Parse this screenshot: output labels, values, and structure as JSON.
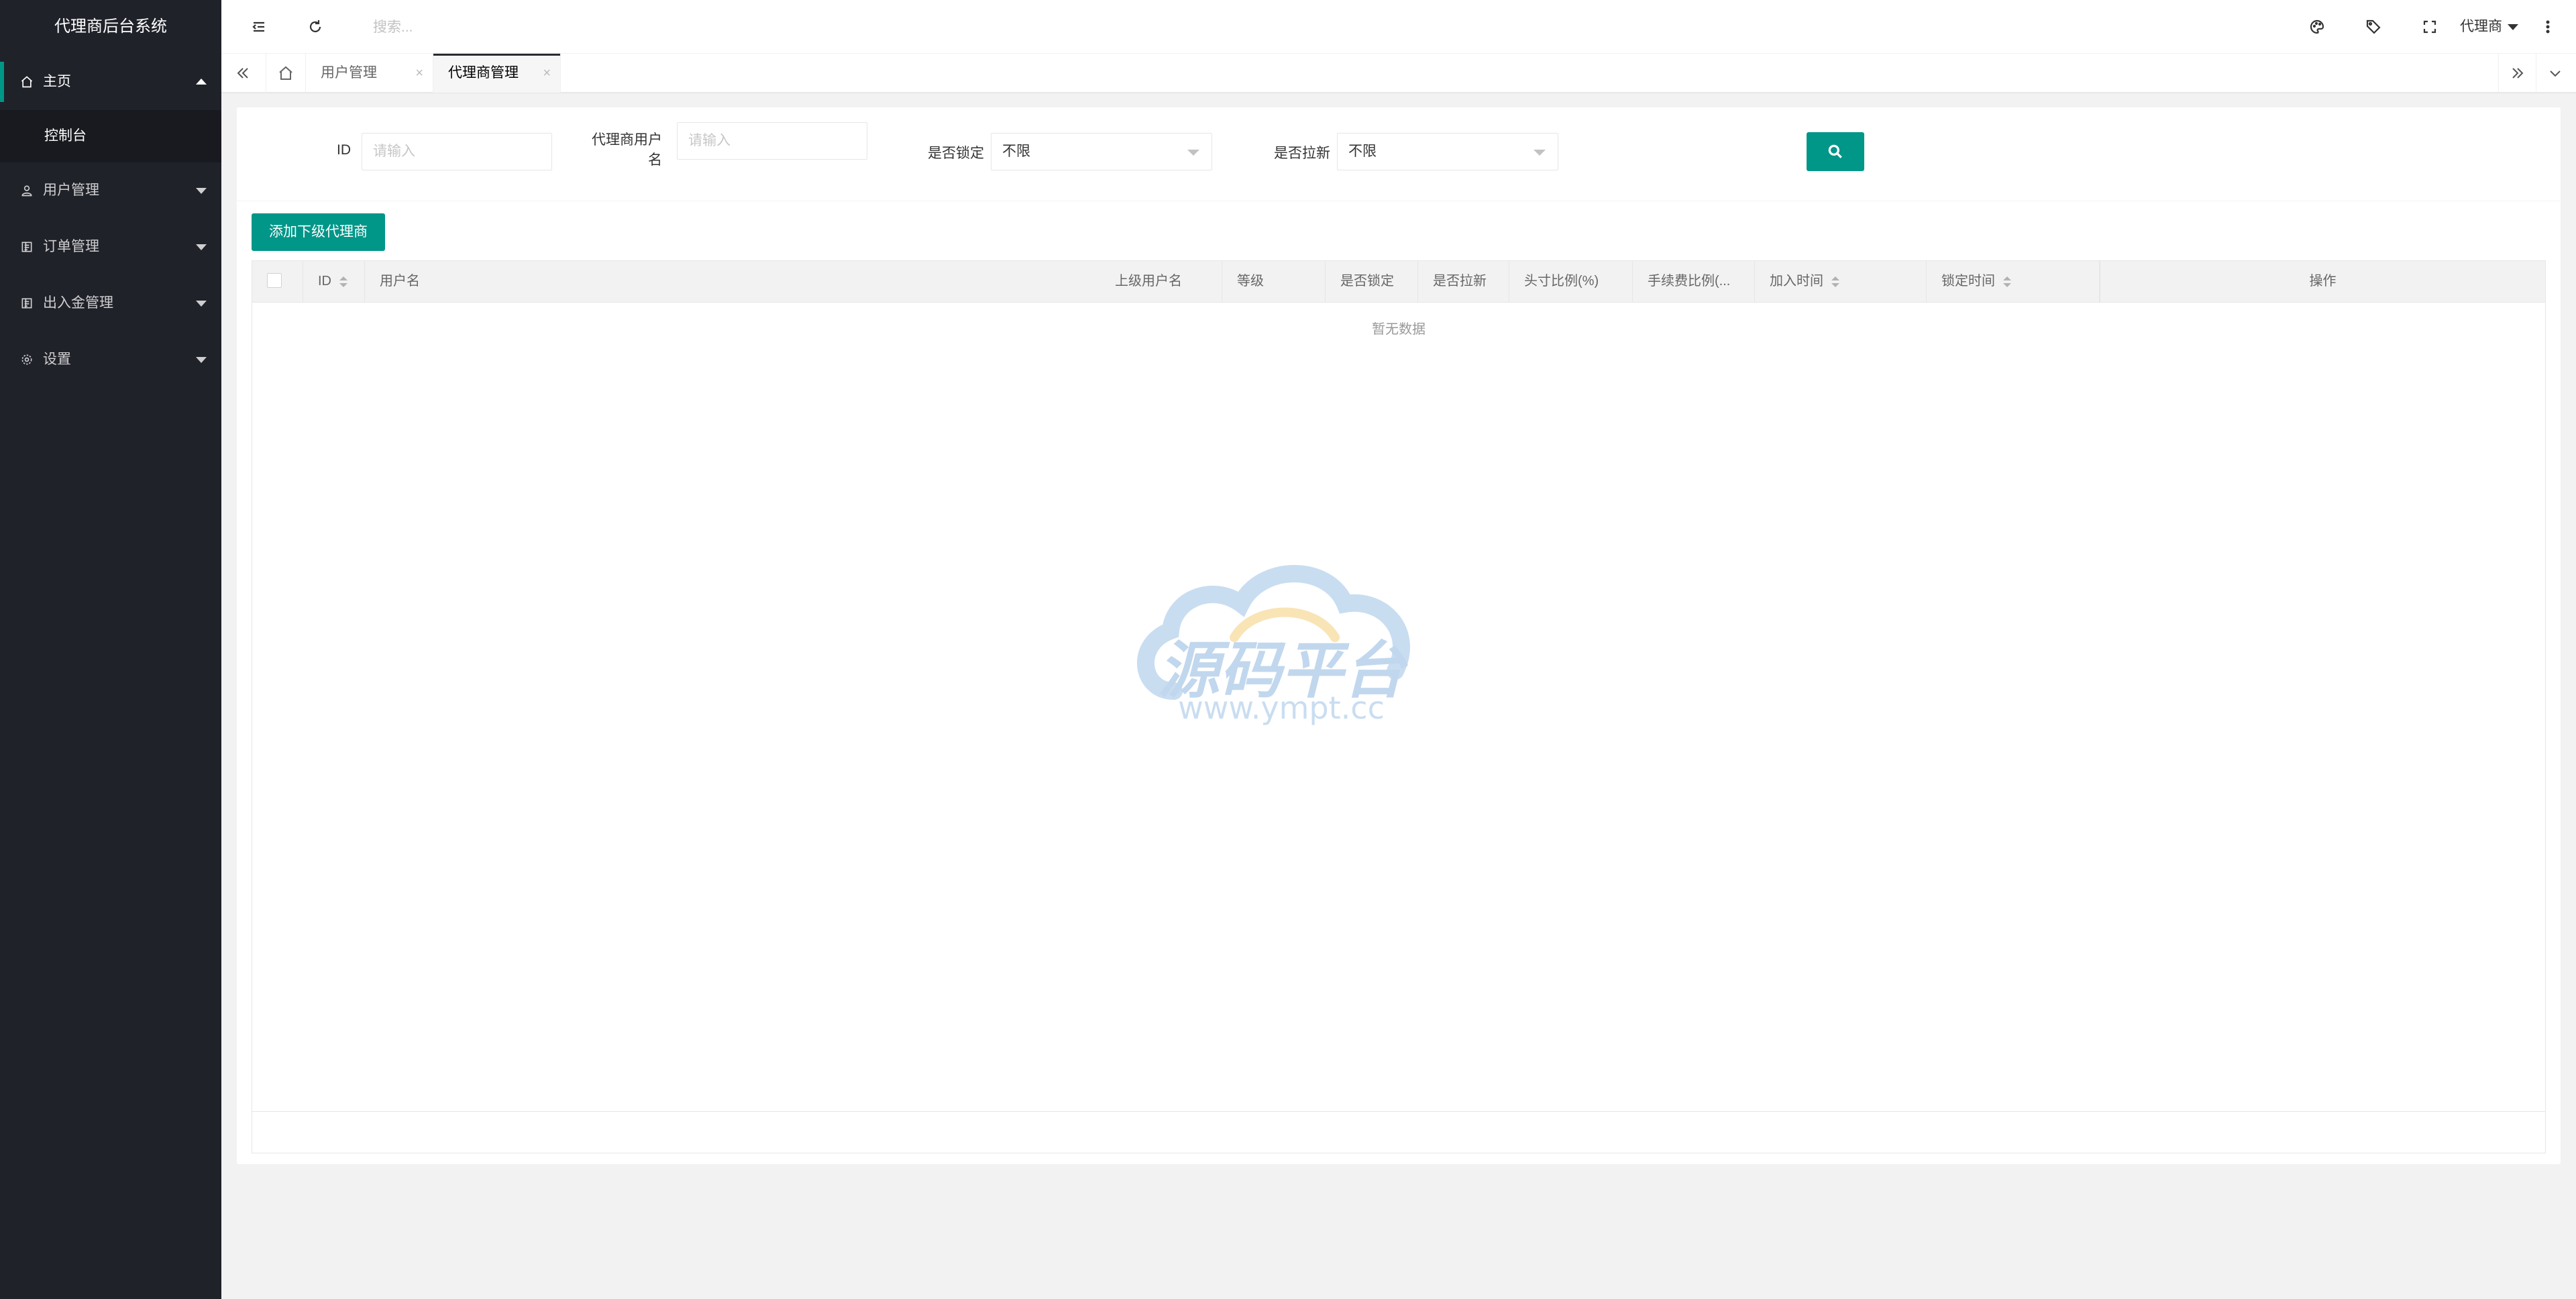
{
  "app": {
    "title": "代理商后台系统"
  },
  "sidebar": {
    "items": [
      {
        "label": "主页",
        "icon": "home-icon",
        "active": true,
        "children": [
          {
            "label": "控制台"
          }
        ]
      },
      {
        "label": "用户管理",
        "icon": "user-icon"
      },
      {
        "label": "订单管理",
        "icon": "order-icon"
      },
      {
        "label": "出入金管理",
        "icon": "funds-icon"
      },
      {
        "label": "设置",
        "icon": "gear-icon"
      }
    ]
  },
  "header": {
    "search_placeholder": "搜索...",
    "user_label": "代理商",
    "icons": [
      "menu-toggle-icon",
      "refresh-icon",
      "palette-icon",
      "tag-icon",
      "fullscreen-icon",
      "more-icon"
    ]
  },
  "tabs": {
    "items": [
      {
        "label": "用户管理",
        "close": "×"
      },
      {
        "label": "代理商管理",
        "close": "×",
        "active": true
      }
    ]
  },
  "filters": {
    "id_label": "ID",
    "id_placeholder": "请输入",
    "username_label_line1": "代理商用户",
    "username_label_line2": "名",
    "username_placeholder": "请输入",
    "locked_label": "是否锁定",
    "locked_value": "不限",
    "pull_label": "是否拉新",
    "pull_value": "不限"
  },
  "actions": {
    "add_label": "添加下级代理商"
  },
  "table": {
    "columns": [
      "ID",
      "用户名",
      "上级用户名",
      "等级",
      "是否锁定",
      "是否拉新",
      "头寸比例(%)",
      "手续费比例(...",
      "加入时间",
      "锁定时间",
      "操作"
    ],
    "empty_text": "暂无数据"
  },
  "watermark": {
    "text": "源码平台",
    "url": "www.ympt.cc"
  },
  "colors": {
    "accent": "#009688",
    "sidebar_bg": "#20222a",
    "sidebar_sub_bg": "#191a20"
  }
}
